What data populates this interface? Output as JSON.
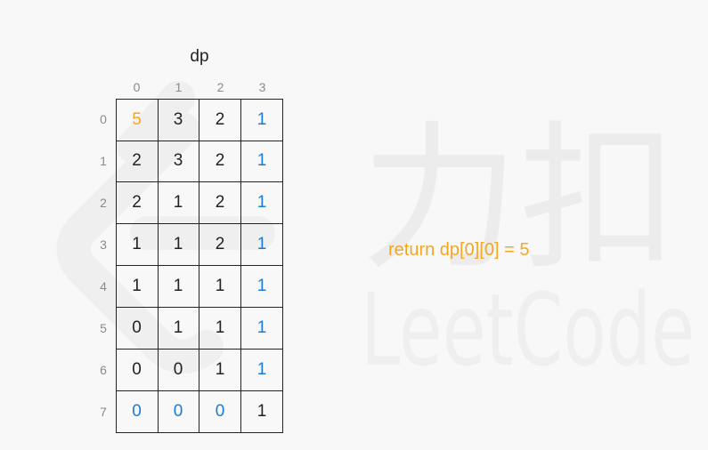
{
  "title": "dp",
  "col_labels": [
    "0",
    "1",
    "2",
    "3"
  ],
  "row_labels": [
    "0",
    "1",
    "2",
    "3",
    "4",
    "5",
    "6",
    "7"
  ],
  "table": [
    [
      {
        "v": "5",
        "c": "orange"
      },
      {
        "v": "3",
        "c": "black"
      },
      {
        "v": "2",
        "c": "black"
      },
      {
        "v": "1",
        "c": "blue"
      }
    ],
    [
      {
        "v": "2",
        "c": "black"
      },
      {
        "v": "3",
        "c": "black"
      },
      {
        "v": "2",
        "c": "black"
      },
      {
        "v": "1",
        "c": "blue"
      }
    ],
    [
      {
        "v": "2",
        "c": "black"
      },
      {
        "v": "1",
        "c": "black"
      },
      {
        "v": "2",
        "c": "black"
      },
      {
        "v": "1",
        "c": "blue"
      }
    ],
    [
      {
        "v": "1",
        "c": "black"
      },
      {
        "v": "1",
        "c": "black"
      },
      {
        "v": "2",
        "c": "black"
      },
      {
        "v": "1",
        "c": "blue"
      }
    ],
    [
      {
        "v": "1",
        "c": "black"
      },
      {
        "v": "1",
        "c": "black"
      },
      {
        "v": "1",
        "c": "black"
      },
      {
        "v": "1",
        "c": "blue"
      }
    ],
    [
      {
        "v": "0",
        "c": "black"
      },
      {
        "v": "1",
        "c": "black"
      },
      {
        "v": "1",
        "c": "black"
      },
      {
        "v": "1",
        "c": "blue"
      }
    ],
    [
      {
        "v": "0",
        "c": "black"
      },
      {
        "v": "0",
        "c": "black"
      },
      {
        "v": "1",
        "c": "black"
      },
      {
        "v": "1",
        "c": "blue"
      }
    ],
    [
      {
        "v": "0",
        "c": "blue"
      },
      {
        "v": "0",
        "c": "blue"
      },
      {
        "v": "0",
        "c": "blue"
      },
      {
        "v": "1",
        "c": "black"
      }
    ]
  ],
  "result": "return dp[0][0] = 5",
  "watermark": {
    "brand_cn": "力扣",
    "brand_en": "LeetCode",
    "icon": "leetcode-logo-icon"
  },
  "colors": {
    "orange": "#f5a623",
    "blue": "#1a7bd6",
    "black": "#222222",
    "background": "#f8f8f8"
  }
}
